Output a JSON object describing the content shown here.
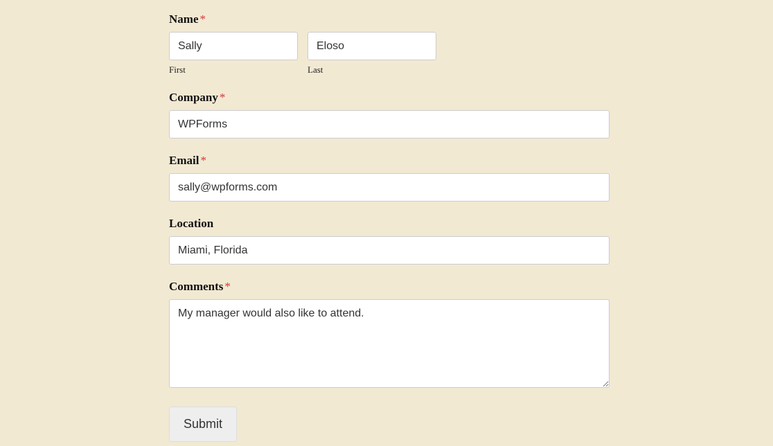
{
  "form": {
    "name": {
      "label": "Name",
      "required": "*",
      "first": {
        "sublabel": "First",
        "value": "Sally"
      },
      "last": {
        "sublabel": "Last",
        "value": "Eloso"
      }
    },
    "company": {
      "label": "Company",
      "required": "*",
      "value": "WPForms"
    },
    "email": {
      "label": "Email",
      "required": "*",
      "value": "sally@wpforms.com"
    },
    "location": {
      "label": "Location",
      "value": "Miami, Florida"
    },
    "comments": {
      "label": "Comments",
      "required": "*",
      "value": "My manager would also like to attend."
    },
    "submit_label": "Submit"
  }
}
